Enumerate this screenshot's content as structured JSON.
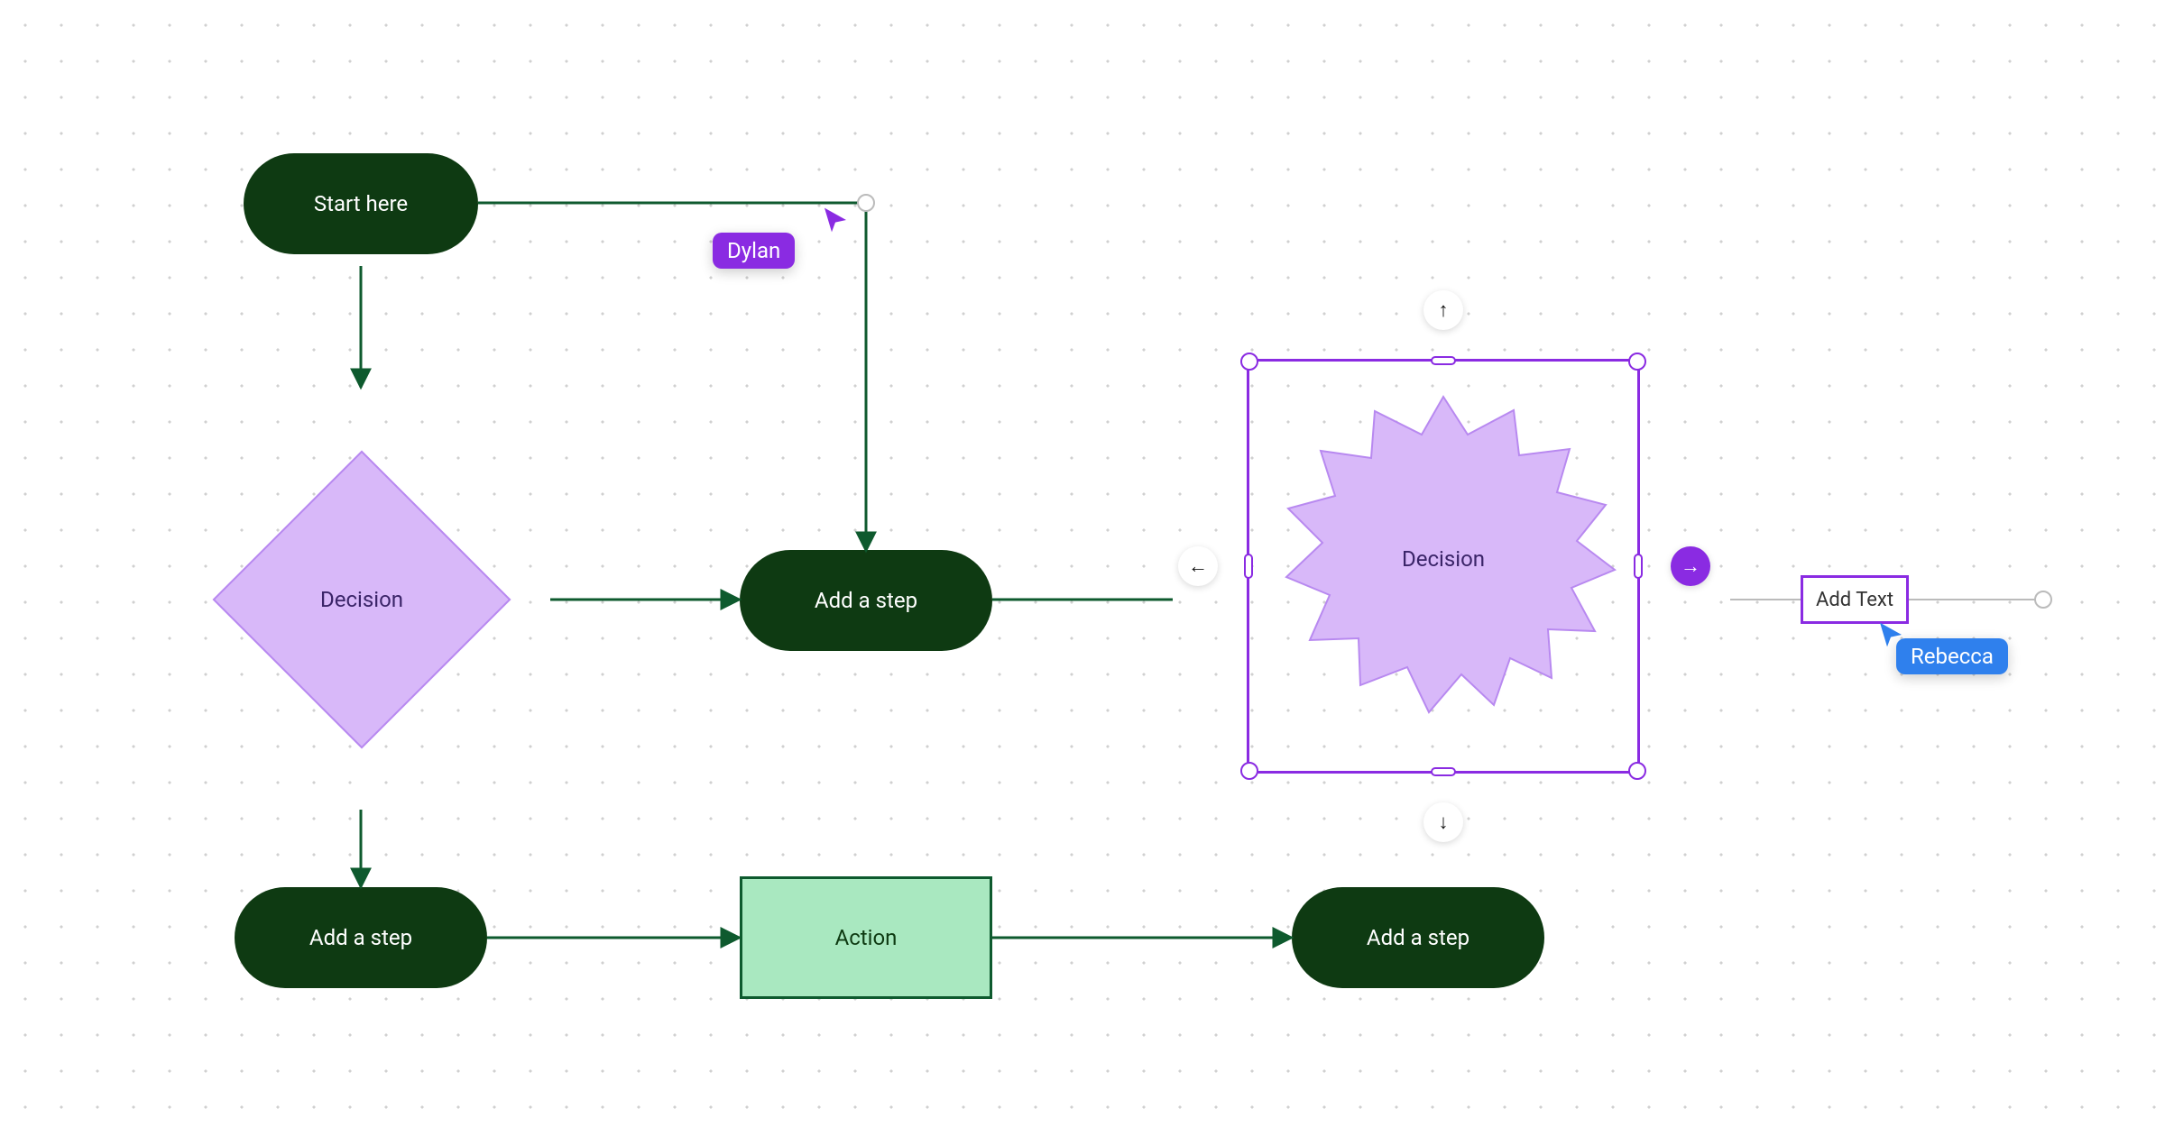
{
  "canvas": {
    "dot_color": "#d0d0d0",
    "bg_color": "#ffffff"
  },
  "nodes": {
    "start": {
      "label": "Start here"
    },
    "decision_diamond": {
      "label": "Decision"
    },
    "add_step_right": {
      "label": "Add a step"
    },
    "add_step_bottom": {
      "label": "Add a step"
    },
    "action": {
      "label": "Action"
    },
    "add_step_far": {
      "label": "Add a step"
    },
    "decision_star": {
      "label": "Decision"
    },
    "add_text": {
      "label": "Add Text"
    }
  },
  "connection_handles": {
    "left_arrow": "←",
    "right_arrow": "→",
    "up_arrow": "↑",
    "down_arrow": "↓"
  },
  "cursors": {
    "dylan": {
      "name": "Dylan",
      "color": "#8a2be2"
    },
    "rebecca": {
      "name": "Rebecca",
      "color": "#2f80ed"
    }
  },
  "colors": {
    "dark_green": "#0e3a12",
    "light_green": "#a9e8c0",
    "green_border": "#0e5a2e",
    "lilac": "#d8b8f9",
    "lilac_border": "#b889f0",
    "purple_accent": "#8a2be2",
    "connector_green": "#0e5a2e"
  }
}
